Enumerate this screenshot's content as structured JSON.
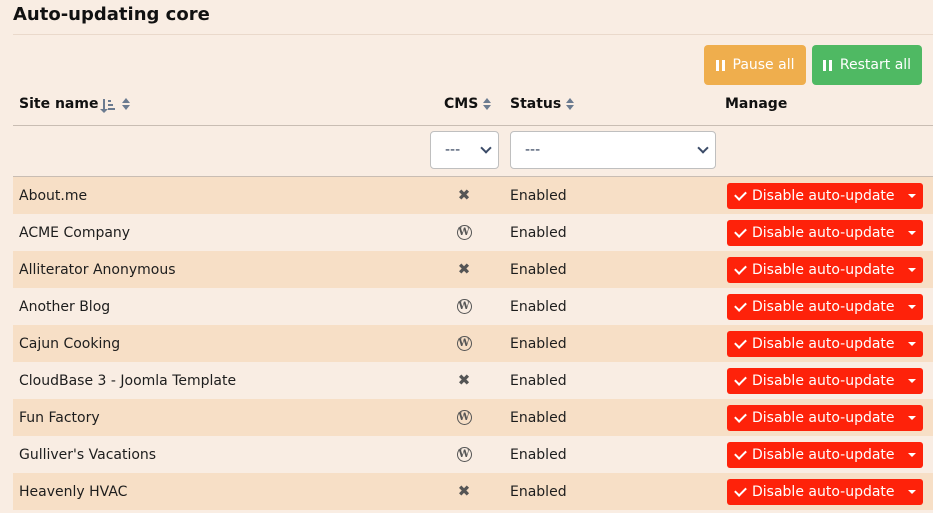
{
  "page": {
    "title": "Auto-updating core"
  },
  "toolbar": {
    "pause_label": "Pause all",
    "restart_label": "Restart all"
  },
  "table": {
    "headers": {
      "site_name": "Site name",
      "cms": "CMS",
      "status": "Status",
      "manage": "Manage"
    },
    "filters": {
      "cms_value": "---",
      "status_value": "---"
    },
    "rows": [
      {
        "name": "About.me",
        "cms": "joomla-icon",
        "status": "Enabled",
        "action": "Disable auto-update"
      },
      {
        "name": "ACME Company",
        "cms": "wordpress-icon",
        "status": "Enabled",
        "action": "Disable auto-update"
      },
      {
        "name": "Alliterator Anonymous",
        "cms": "joomla-icon",
        "status": "Enabled",
        "action": "Disable auto-update"
      },
      {
        "name": "Another Blog",
        "cms": "wordpress-icon",
        "status": "Enabled",
        "action": "Disable auto-update"
      },
      {
        "name": "Cajun Cooking",
        "cms": "wordpress-icon",
        "status": "Enabled",
        "action": "Disable auto-update"
      },
      {
        "name": "CloudBase 3 - Joomla Template",
        "cms": "joomla-icon",
        "status": "Enabled",
        "action": "Disable auto-update"
      },
      {
        "name": "Fun Factory",
        "cms": "wordpress-icon",
        "status": "Enabled",
        "action": "Disable auto-update"
      },
      {
        "name": "Gulliver's Vacations",
        "cms": "wordpress-icon",
        "status": "Enabled",
        "action": "Disable auto-update"
      },
      {
        "name": "Heavenly HVAC",
        "cms": "joomla-icon",
        "status": "Enabled",
        "action": "Disable auto-update"
      }
    ]
  },
  "colors": {
    "background": "#f9ede3",
    "row_stripe": "#f7dfc6",
    "pause": "#efae4d",
    "restart": "#4fb963",
    "disable": "#fe220a"
  }
}
